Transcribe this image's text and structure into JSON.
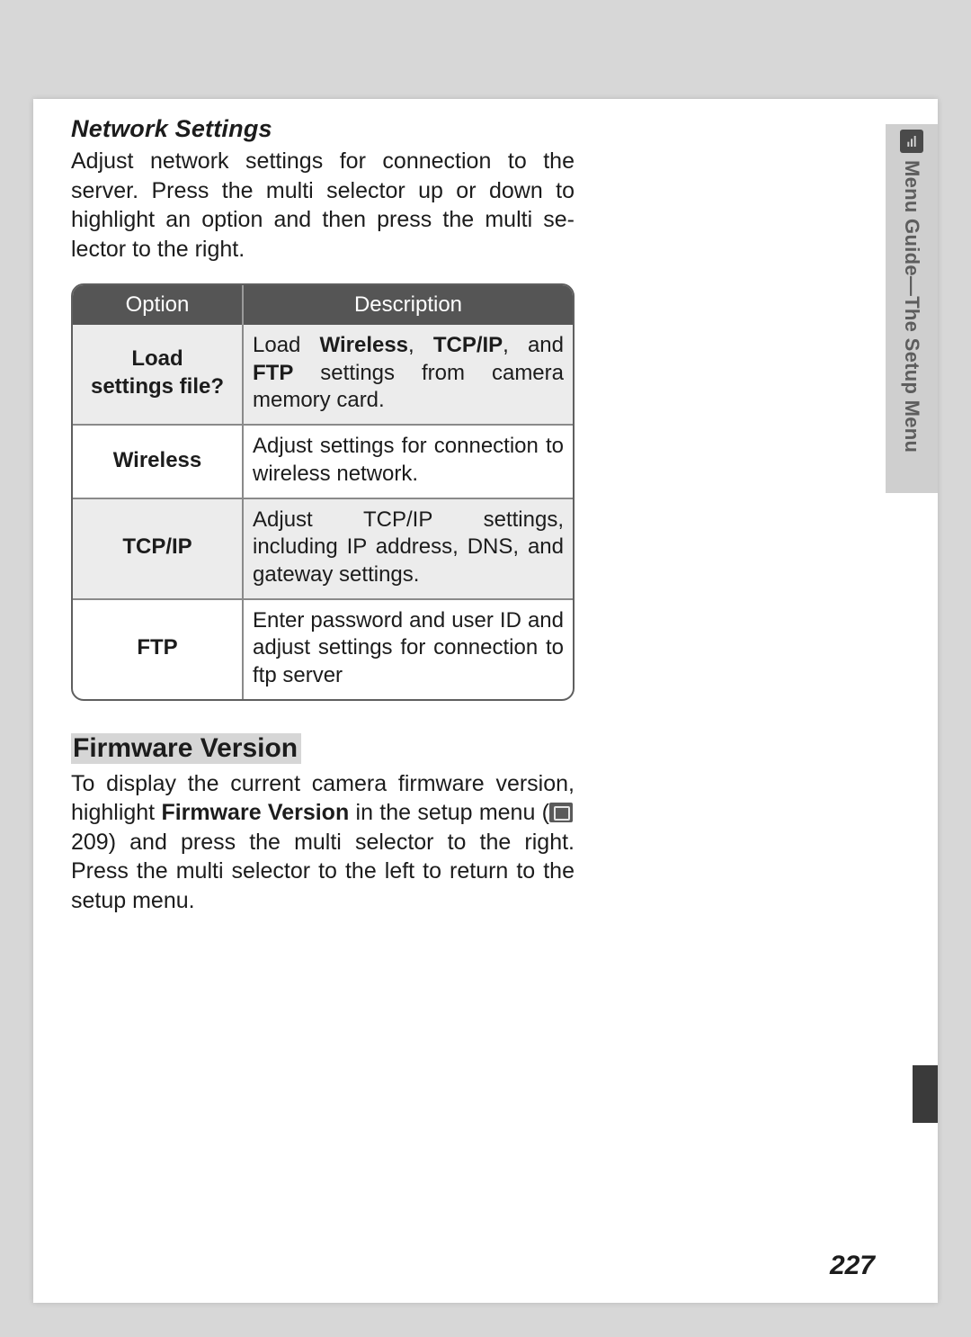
{
  "side_tab": {
    "label": "Menu Guide—The Setup Menu",
    "icon_name": "setup-icon"
  },
  "section1": {
    "title": "Network Settings",
    "body_pre": "Adjust network settings for connection to the server.  Press the multi selector up or down to highlight an option and then press the multi se­lector to the right."
  },
  "table": {
    "header": {
      "col_option": "Option",
      "col_description": "Description"
    },
    "rows": [
      {
        "option": "Load\nsettings file?",
        "desc_parts": [
          {
            "t": "Load ",
            "b": false
          },
          {
            "t": "Wireless",
            "b": true
          },
          {
            "t": ", ",
            "b": false
          },
          {
            "t": "TCP/IP",
            "b": true
          },
          {
            "t": ", and ",
            "b": false
          },
          {
            "t": "FTP",
            "b": true
          },
          {
            "t": " set­tings from camera memory card.",
            "b": false
          }
        ],
        "shade": true
      },
      {
        "option": "Wireless",
        "desc_parts": [
          {
            "t": "Adjust settings for connection to wire­less network.",
            "b": false
          }
        ],
        "shade": false
      },
      {
        "option": "TCP/IP",
        "desc_parts": [
          {
            "t": "Adjust TCP/IP settings, including IP ad­dress, DNS, and gateway settings.",
            "b": false
          }
        ],
        "shade": true
      },
      {
        "option": "FTP",
        "desc_parts": [
          {
            "t": "Enter password and user ID and adjust settings for connection to ftp server",
            "b": false
          }
        ],
        "shade": false
      }
    ]
  },
  "section2": {
    "heading": "Firmware Version",
    "body_parts": [
      {
        "t": "To display the current camera firmware version, highlight ",
        "b": false
      },
      {
        "t": "Firmware Version",
        "b": true
      },
      {
        "t": " in the setup menu (",
        "b": false
      },
      {
        "t": "__ICON__",
        "b": false
      },
      {
        "t": " 209) and press the multi selector to the right. Press the multi selector to the left to return to the setup menu.",
        "b": false
      }
    ]
  },
  "page_number": "227"
}
